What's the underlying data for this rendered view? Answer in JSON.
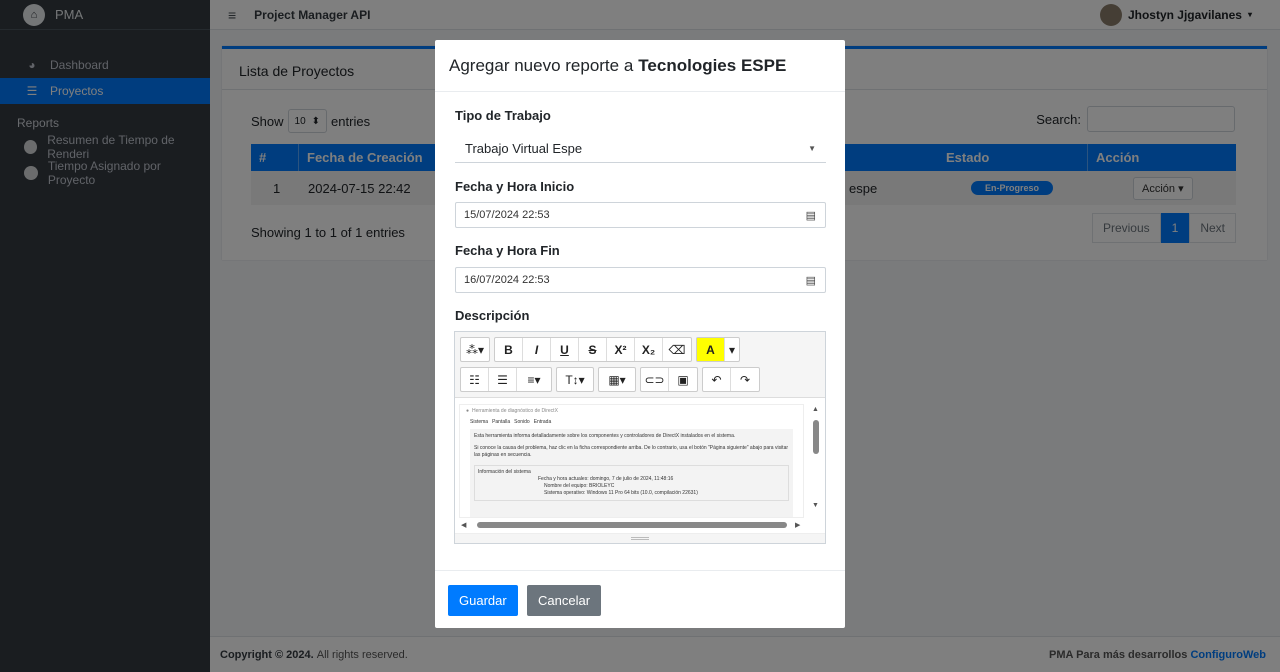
{
  "sidebar": {
    "brand": "PMA",
    "items": [
      {
        "label": "Dashboard",
        "icon": "dashboard-icon"
      },
      {
        "label": "Proyectos",
        "icon": "list-icon",
        "active": true
      }
    ],
    "section_header": "Reports",
    "reports": [
      {
        "label": "Resumen de Tiempo de Renderi"
      },
      {
        "label": "Tiempo Asignado por Proyecto"
      }
    ]
  },
  "topbar": {
    "title": "Project Manager API",
    "user": "Jhostyn Jjgavilanes"
  },
  "card": {
    "title": "Lista de Proyectos",
    "show_label": "Show",
    "entries_value": "10",
    "entries_label": "entries",
    "search_label": "Search:",
    "columns": [
      "#",
      "Fecha de Creación",
      "Estado",
      "Acción"
    ],
    "row": {
      "index": "1",
      "date": "2024-07-15 22:42",
      "name_partial": "espe",
      "status": "En-Progreso",
      "action": "Acción"
    },
    "showing": "Showing 1 to 1 of 1 entries",
    "pager": {
      "prev": "Previous",
      "page": "1",
      "next": "Next"
    }
  },
  "footer": {
    "copyright": "Copyright © 2024.",
    "rights": "All rights reserved.",
    "right_text": "PMA Para más desarrollos",
    "right_link": "ConfiguroWeb"
  },
  "modal": {
    "title_prefix": "Agregar nuevo reporte a",
    "title_project": "Tecnologies ESPE",
    "tipo_label": "Tipo de Trabajo",
    "tipo_value": "Trabajo Virtual Espe",
    "inicio_label": "Fecha y Hora Inicio",
    "inicio_value": "15/07/2024 22:53",
    "fin_label": "Fecha y Hora Fin",
    "fin_value": "16/07/2024 22:53",
    "desc_label": "Descripción",
    "editor_content": {
      "window_title": "Herramienta de diagnóstico de DirectX",
      "tabs": [
        "Sistema",
        "Pantalla",
        "Sonido",
        "Entrada"
      ],
      "p1": "Esta herramienta informa detalladamente sobre los componentes y controladores de DirectX instalados en el sistema.",
      "p2": "Si conoce la causa del problema, haz clic en la ficha correspondiente arriba. De lo contrario, usa el botón \"Página siguiente\" abajo para visitar las páginas en secuencia.",
      "info_header": "Información del sistema",
      "info1": "Fecha y hora actuales:  domingo, 7 de julio de 2024, 11:48:16",
      "info2": "Nombre del equipo:  BRIOLEYC",
      "info3": "Sistema operativo:  Windows 11 Pro 64 bits (10.0, compilación 22631)"
    },
    "save": "Guardar",
    "cancel": "Cancelar"
  },
  "colors": {
    "primary": "#007bff",
    "sidebar": "#343a40",
    "secondary": "#6c757d"
  }
}
